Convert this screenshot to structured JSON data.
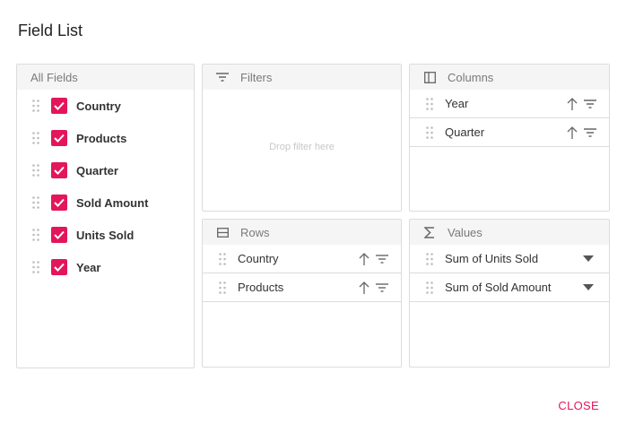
{
  "dialog": {
    "title": "Field List",
    "close_label": "CLOSE"
  },
  "all_fields": {
    "header": "All Fields",
    "items": [
      {
        "label": "Country",
        "checked": true
      },
      {
        "label": "Products",
        "checked": true
      },
      {
        "label": "Quarter",
        "checked": true
      },
      {
        "label": "Sold Amount",
        "checked": true
      },
      {
        "label": "Units Sold",
        "checked": true
      },
      {
        "label": "Year",
        "checked": true
      }
    ]
  },
  "filters": {
    "header": "Filters",
    "drop_hint": "Drop filter here",
    "icon": "filter-icon"
  },
  "columns": {
    "header": "Columns",
    "icon": "columns-icon",
    "items": [
      {
        "label": "Year"
      },
      {
        "label": "Quarter"
      }
    ]
  },
  "rows": {
    "header": "Rows",
    "icon": "rows-icon",
    "items": [
      {
        "label": "Country"
      },
      {
        "label": "Products"
      }
    ]
  },
  "values": {
    "header": "Values",
    "icon": "sigma-icon",
    "items": [
      {
        "label": "Sum of Units Sold"
      },
      {
        "label": "Sum of Sold Amount"
      }
    ]
  },
  "colors": {
    "accent": "#e3165b",
    "border": "#dcdcdc",
    "header_bg": "#f5f5f5"
  }
}
